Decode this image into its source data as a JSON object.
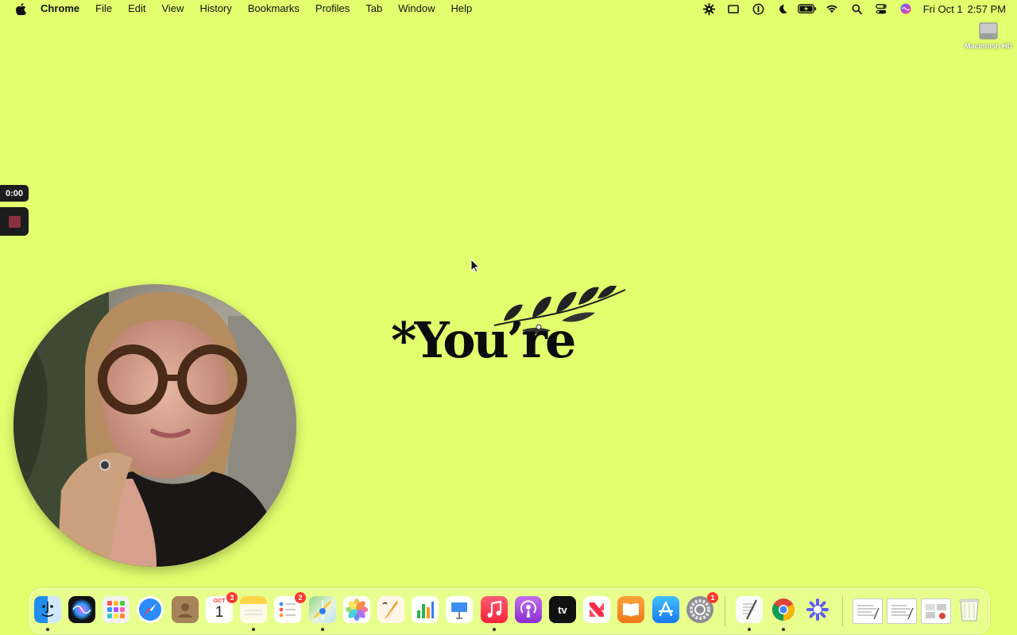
{
  "menubar": {
    "app_name": "Chrome",
    "menus": [
      "File",
      "Edit",
      "View",
      "History",
      "Bookmarks",
      "Profiles",
      "Tab",
      "Window",
      "Help"
    ],
    "status_icons": [
      "settings-gear-icon",
      "screen-mirror-icon",
      "password-manager-icon",
      "focus-moon-icon",
      "battery-icon",
      "wifi-icon",
      "spotlight-search-icon",
      "control-center-icon",
      "siri-icon"
    ],
    "clock_date": "Fri Oct 1",
    "clock_time": "2:57 PM"
  },
  "desktop": {
    "disk_label": "Macintosh HD",
    "background_color": "#E2FF6E"
  },
  "recorder": {
    "timer": "0:00"
  },
  "slide": {
    "word": "*You’re"
  },
  "dock": {
    "apps": [
      {
        "name": "Finder",
        "icon": "finder-icon",
        "running": true
      },
      {
        "name": "Siri",
        "icon": "siri-icon",
        "running": false
      },
      {
        "name": "Launchpad",
        "icon": "launchpad-icon",
        "running": false
      },
      {
        "name": "Safari",
        "icon": "safari-icon",
        "running": false
      },
      {
        "name": "Contacts",
        "icon": "contacts-icon",
        "running": false
      },
      {
        "name": "Calendar",
        "icon": "calendar-icon",
        "running": false,
        "badge": "3",
        "month": "OCT",
        "day": "1"
      },
      {
        "name": "Notes",
        "icon": "notes-icon",
        "running": true
      },
      {
        "name": "Reminders",
        "icon": "reminders-icon",
        "running": false,
        "badge": "2"
      },
      {
        "name": "Maps",
        "icon": "maps-icon",
        "running": true
      },
      {
        "name": "Photos",
        "icon": "photos-icon",
        "running": false
      },
      {
        "name": "Pages",
        "icon": "pages-icon",
        "running": false
      },
      {
        "name": "Numbers",
        "icon": "numbers-icon",
        "running": false
      },
      {
        "name": "Keynote",
        "icon": "keynote-icon",
        "running": false
      },
      {
        "name": "Music",
        "icon": "music-icon",
        "running": true
      },
      {
        "name": "Podcasts",
        "icon": "podcasts-icon",
        "running": false
      },
      {
        "name": "TV",
        "icon": "apple-tv-icon",
        "running": false,
        "label": "tv"
      },
      {
        "name": "News",
        "icon": "news-icon",
        "running": false
      },
      {
        "name": "Books",
        "icon": "books-icon",
        "running": false
      },
      {
        "name": "App Store",
        "icon": "app-store-icon",
        "running": false
      },
      {
        "name": "System Preferences",
        "icon": "system-preferences-icon",
        "running": false,
        "badge": "1"
      },
      {
        "name": "TextEdit",
        "icon": "textedit-icon",
        "running": true
      },
      {
        "name": "Chrome",
        "icon": "chrome-icon",
        "running": true
      },
      {
        "name": "Loom",
        "icon": "loom-icon",
        "running": false
      }
    ],
    "recents": [
      {
        "icon": "document-thumbnail-icon"
      },
      {
        "icon": "document-thumbnail-icon"
      },
      {
        "icon": "document-thumbnail-icon"
      },
      {
        "icon": "trash-icon"
      }
    ]
  }
}
